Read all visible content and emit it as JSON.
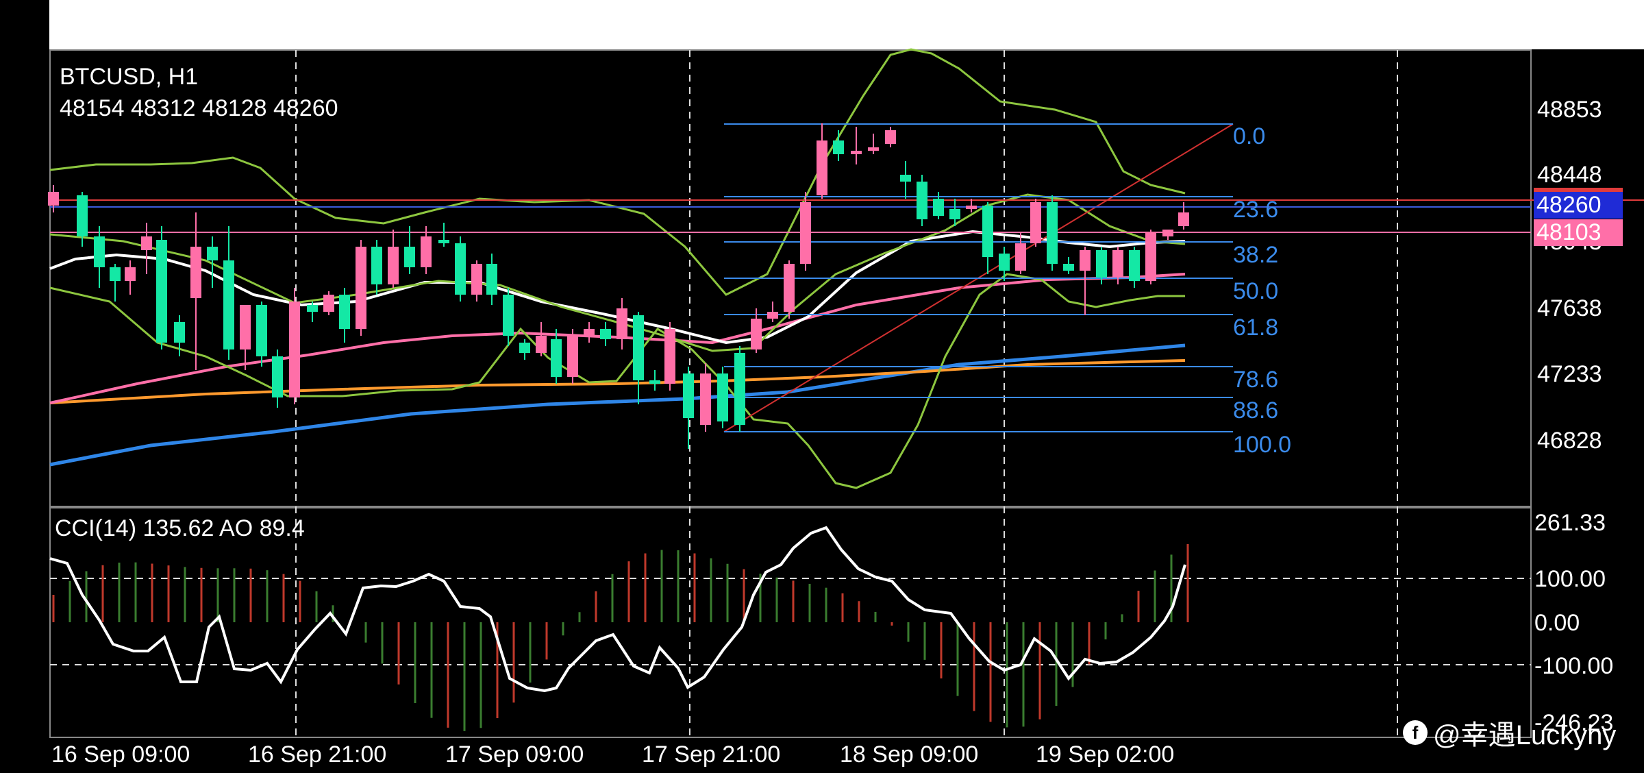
{
  "header": {
    "symbol": "BTCUSD, H1",
    "ohlc": "48154 48312 48128 48260"
  },
  "price_axis": {
    "ticks": [
      "48853",
      "48448",
      "47638",
      "47233",
      "46828"
    ],
    "hidden_tick": "48043",
    "current_price": "48260",
    "current_price_color": "#1f2bd6",
    "marker_price": "48103",
    "marker_color": "#ff6fa8"
  },
  "fibonacci": {
    "levels": [
      "0.0",
      "23.6",
      "38.2",
      "50.0",
      "61.8",
      "78.6",
      "88.6",
      "100.0"
    ],
    "color": "#3b8beb"
  },
  "indicator": {
    "label": "CCI(14) 135.62 AO 89.4",
    "ticks": [
      "261.33",
      "100.00",
      "0.00",
      "-100.00",
      "-246.23"
    ]
  },
  "time_axis": {
    "labels": [
      "16 Sep 09:00",
      "16 Sep 21:00",
      "17 Sep 09:00",
      "17 Sep 21:00",
      "18 Sep 09:00",
      "19 Sep 02:00"
    ]
  },
  "watermark": {
    "text": "@幸遇Luckyhy"
  },
  "colors": {
    "bull": "#14e8a5",
    "bear": "#ff6fa8",
    "bollinger": "#8dc63f",
    "ema_fast": "#ffffff",
    "ema_mid": "#ff6fa8",
    "ema_slow": "#ff9a2e",
    "ema_long": "#2f86e8"
  }
}
